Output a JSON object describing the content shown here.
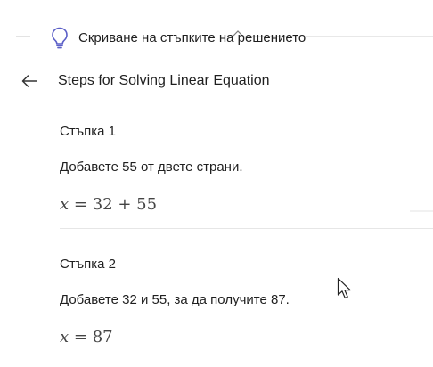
{
  "toolbar": {
    "hide_steps_label": "Скриване на стъпките на решението",
    "hide_steps_icon": "lightbulb-icon"
  },
  "header": {
    "back_icon": "arrow-left-icon",
    "title": "Steps for Solving Linear Equation"
  },
  "steps": [
    {
      "title": "Стъпка 1",
      "description": "Добавете 55 от двете страни.",
      "math": {
        "variable": "x",
        "rhs": "= 32 + 55"
      }
    },
    {
      "title": "Стъпка 2",
      "description": "Добавете 32 и 55, за да получите 87.",
      "math": {
        "variable": "x",
        "rhs": "= 87"
      }
    }
  ],
  "colors": {
    "text": "#1f1f1f",
    "math": "#444444",
    "divider": "#e6e6e6"
  }
}
